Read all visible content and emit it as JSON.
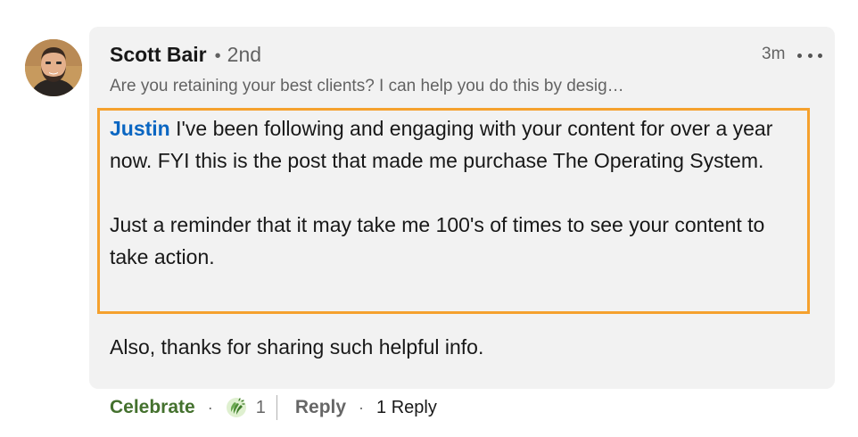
{
  "comment": {
    "author_name": "Scott Bair",
    "connection_degree": "2nd",
    "timestamp": "3m",
    "headline": "Are you retaining your best clients? I can help you do this by desig…",
    "mention": "Justin",
    "paragraph1_text": " I've been following and engaging with your content for over a year now. FYI this is the post that made me purchase The Operating System.",
    "paragraph2_text": "Just a reminder that it may take me 100's of times to see your content to take action.",
    "paragraph3_text": "Also, thanks for sharing such helpful info.",
    "highlight_color": "#f5a12e"
  },
  "actions": {
    "reaction_label": "Celebrate",
    "reaction_label_color": "#44712e",
    "reaction_icon": "celebrate-clapping-hands-icon",
    "reaction_count": "1",
    "reply_label": "Reply",
    "reply_count_text": "1 Reply"
  },
  "icons": {
    "more": "more-horizontal-icon",
    "avatar": "profile-photo"
  }
}
